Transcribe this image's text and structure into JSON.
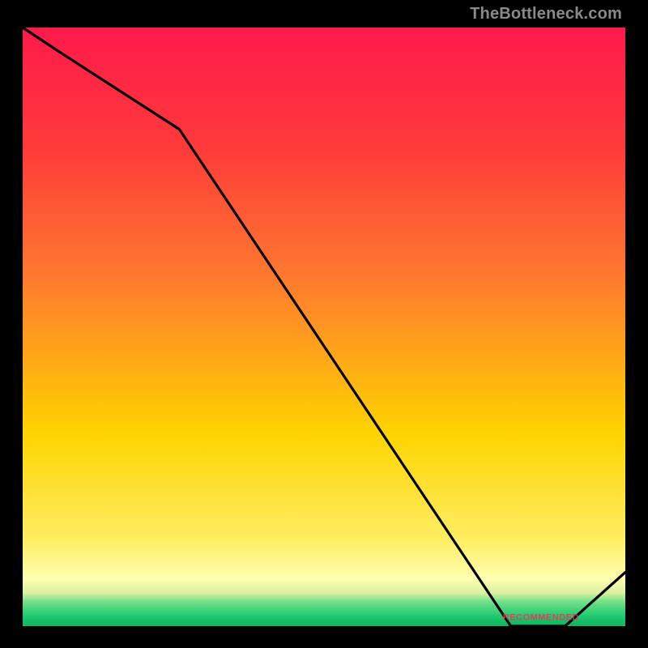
{
  "attribution": "TheBottleneck.com",
  "chart_data": {
    "type": "line",
    "title": "",
    "xlabel": "",
    "ylabel": "",
    "x": [
      0.0,
      0.06,
      0.26,
      0.81,
      0.9,
      1.0
    ],
    "values": [
      1.0,
      0.96,
      0.83,
      0.0,
      0.0,
      0.09
    ],
    "xlim": [
      0,
      1
    ],
    "ylim": [
      0,
      1
    ],
    "colors": {
      "top": "#ff1a4b",
      "mid1": "#ff7a2e",
      "mid2": "#ffd400",
      "pale": "#ffffb0",
      "green1": "#7be08a",
      "green2": "#1cc76d",
      "line": "#000000",
      "axes": "#000000",
      "annotation": "#ff2a55"
    },
    "annotation_text": "RECOMMENDED",
    "annotation_x": 0.86
  }
}
